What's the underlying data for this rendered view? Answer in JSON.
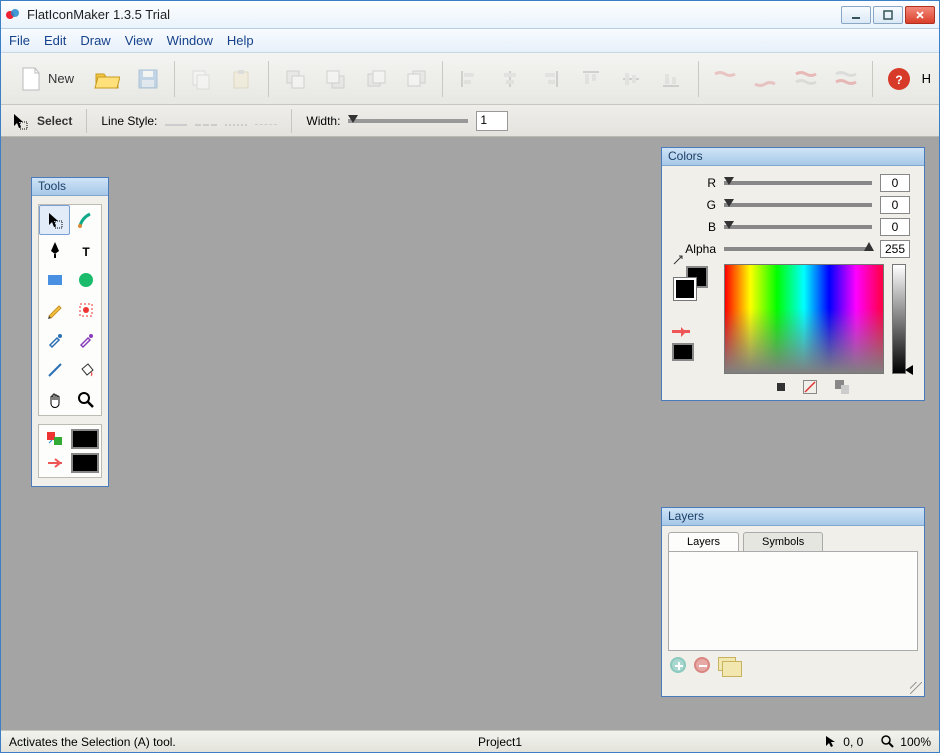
{
  "app": {
    "title": "FlatIconMaker 1.3.5 Trial"
  },
  "menu": {
    "items": [
      "File",
      "Edit",
      "Draw",
      "View",
      "Window",
      "Help"
    ]
  },
  "toolbar": {
    "new_label": "New",
    "help_abbrev": "H"
  },
  "options": {
    "tool_label": "Select",
    "line_style_label": "Line Style:",
    "width_label": "Width:",
    "width_value": "1"
  },
  "tools_panel": {
    "title": "Tools"
  },
  "colors_panel": {
    "title": "Colors",
    "r_label": "R",
    "r_value": "0",
    "g_label": "G",
    "g_value": "0",
    "b_label": "B",
    "b_value": "0",
    "alpha_label": "Alpha",
    "alpha_value": "255"
  },
  "layers_panel": {
    "title": "Layers",
    "tab_layers": "Layers",
    "tab_symbols": "Symbols"
  },
  "status": {
    "hint": "Activates the Selection (A) tool.",
    "project": "Project1",
    "coords": "0, 0",
    "zoom": "100%"
  }
}
